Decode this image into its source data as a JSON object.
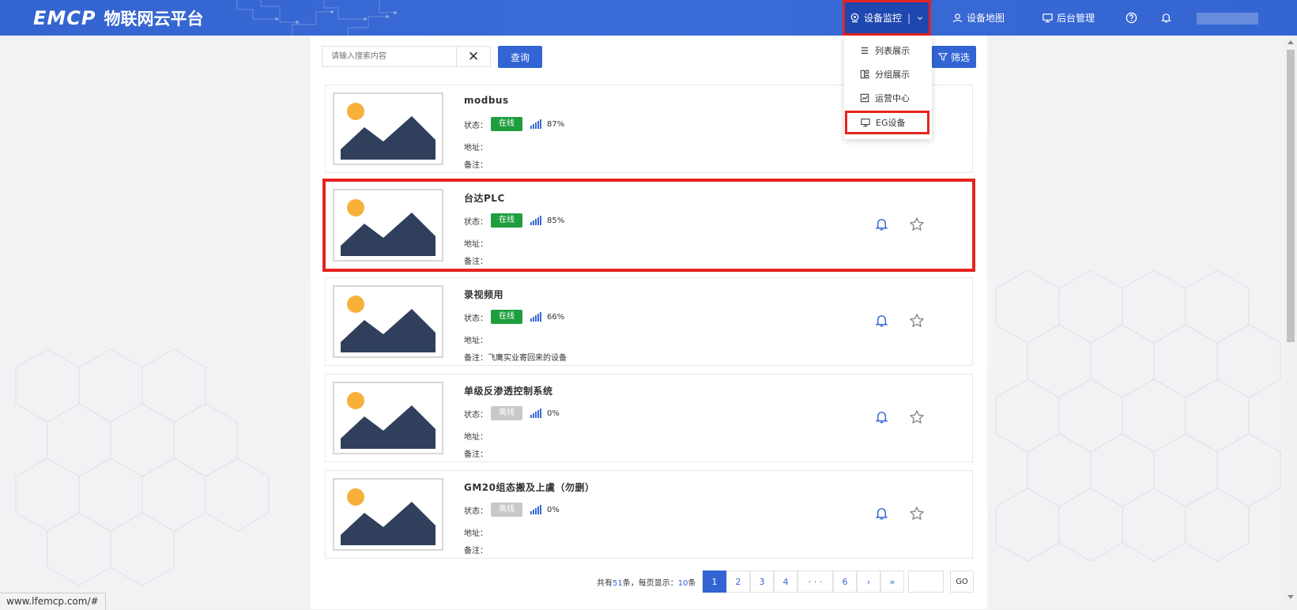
{
  "header": {
    "logo_mark": "EMCP",
    "logo_text": "物联网云平台",
    "nav": {
      "device_monitor": "设备监控",
      "device_map": "设备地图",
      "admin": "后台管理"
    }
  },
  "dropdown": {
    "items": [
      {
        "label": "列表展示",
        "icon": "list-icon"
      },
      {
        "label": "分组展示",
        "icon": "group-icon"
      },
      {
        "label": "运营中心",
        "icon": "chart-icon"
      },
      {
        "label": "EG设备",
        "icon": "monitor-icon"
      }
    ]
  },
  "search": {
    "placeholder": "请输入搜索内容",
    "clear": "✕",
    "query_label": "查询",
    "filter_label": "筛选"
  },
  "labels": {
    "status": "状态：",
    "address": "地址：",
    "note": "备注："
  },
  "devices": [
    {
      "name": "modbus",
      "status": "在线",
      "online": true,
      "signal": "87%",
      "signal_level": 0.87,
      "address": "",
      "note": ""
    },
    {
      "name": "台达PLC",
      "status": "在线",
      "online": true,
      "signal": "85%",
      "signal_level": 0.85,
      "address": "",
      "note": ""
    },
    {
      "name": "录视频用",
      "status": "在线",
      "online": true,
      "signal": "66%",
      "signal_level": 0.66,
      "address": "",
      "note": "飞鹰实业寄回来的设备"
    },
    {
      "name": "单级反渗透控制系统",
      "status": "离线",
      "online": false,
      "signal": "0%",
      "signal_level": 0,
      "address": "",
      "note": ""
    },
    {
      "name": "GM20组态搬及上虞（勿删）",
      "status": "离线",
      "online": false,
      "signal": "0%",
      "signal_level": 0,
      "address": "",
      "note": ""
    }
  ],
  "pagination": {
    "total_prefix": "共有",
    "total": "51",
    "total_suffix": "条，每页显示：",
    "per_page": "10",
    "per_page_suffix": "条",
    "pages": [
      "1",
      "2",
      "3",
      "4",
      "· · ·",
      "6",
      "›",
      "»"
    ],
    "current": "1",
    "go": "GO"
  },
  "status_bar": {
    "url": "www.lfemcp.com/#"
  },
  "colors": {
    "brand": "#3364d4",
    "online": "#1f9e3f",
    "offline": "#c8c8c8",
    "highlight": "#e5231f"
  }
}
